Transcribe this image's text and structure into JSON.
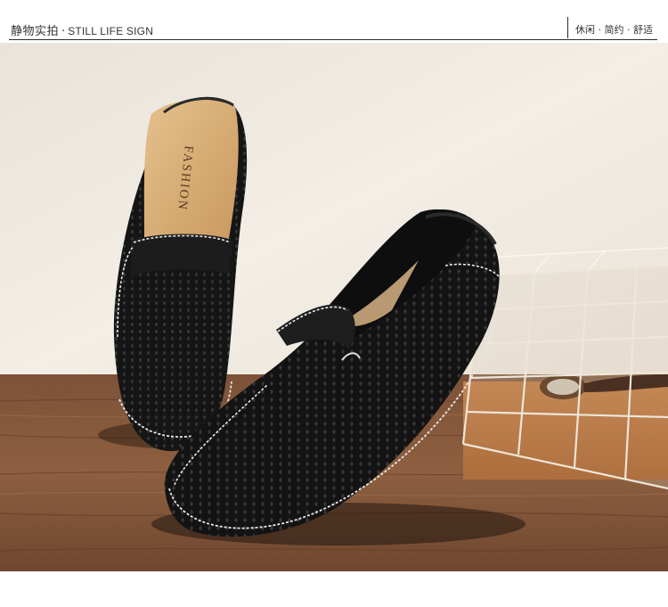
{
  "header": {
    "title_cn": "静物实拍",
    "separator": "·",
    "title_en": "STILL LIFE SIGN",
    "tags": "休闲 · 简约 · 舒适"
  },
  "photo": {
    "insole_text": "FASHION",
    "colors": {
      "wall": "#efe9e1",
      "wood": "#8a5a3b",
      "shoe": "#151515",
      "insole": "#d9b281",
      "stitch": "#f0f0f0",
      "basket": "#e6dccc"
    }
  }
}
